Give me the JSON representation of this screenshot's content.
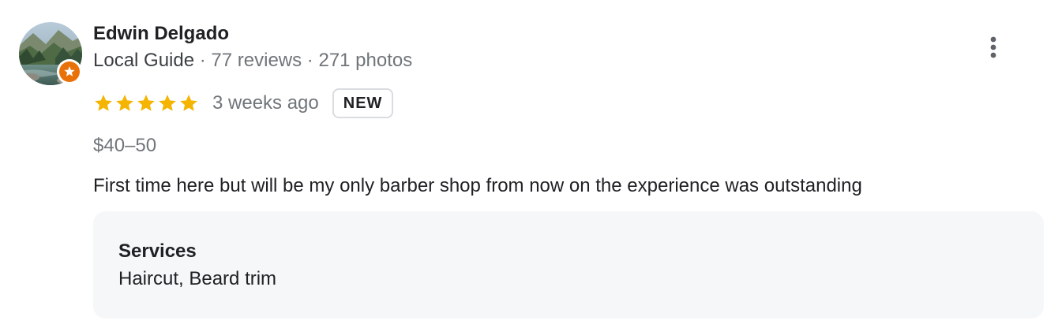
{
  "reviewer": {
    "name": "Edwin Delgado",
    "badge": "Local Guide",
    "separator": " · ",
    "reviews": "77 reviews",
    "photos": "271 photos",
    "avatar_icon": "landscape-photo-avatar",
    "badge_icon": "local-guide-star-icon",
    "badge_color": "#e8710a"
  },
  "review": {
    "rating": 5,
    "rating_max": 5,
    "star_color": "#f4b400",
    "time": "3 weeks ago",
    "new_label": "NEW",
    "price": "$40–50",
    "text": "First time here but will be my only barber shop from now on the experience was outstanding"
  },
  "services": {
    "title": "Services",
    "value": "Haircut, Beard trim"
  },
  "menu": {
    "icon": "more-vertical-icon"
  }
}
